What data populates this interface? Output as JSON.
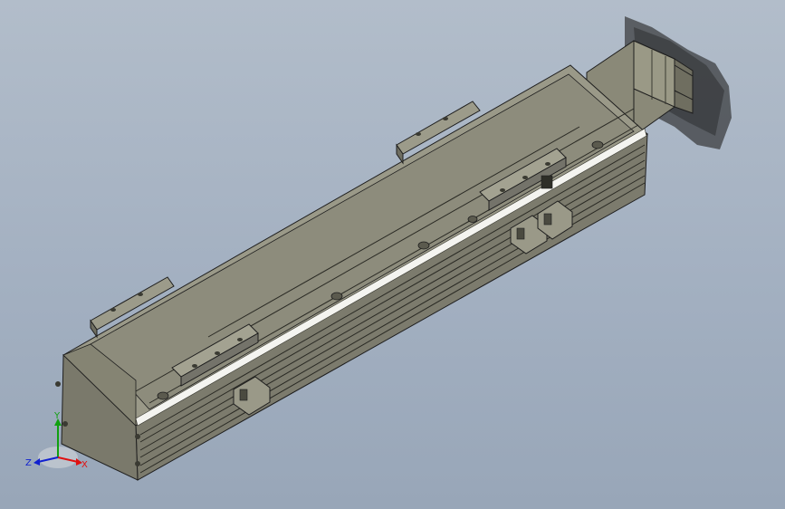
{
  "viewport": {
    "background_top": "#b2bdca",
    "background_bottom": "#98a6b8"
  },
  "model": {
    "description_icon": "linear-module-3d-model",
    "body_color": "#8c8b7b",
    "face_dark": "#5f5e52",
    "edge_color": "#1e1e1e",
    "motor_color": "#8a8978"
  },
  "triad": {
    "x_label": "X",
    "y_label": "Y",
    "z_label": "Z",
    "x_color": "#e01010",
    "y_color": "#10a010",
    "z_color": "#1020d0"
  }
}
